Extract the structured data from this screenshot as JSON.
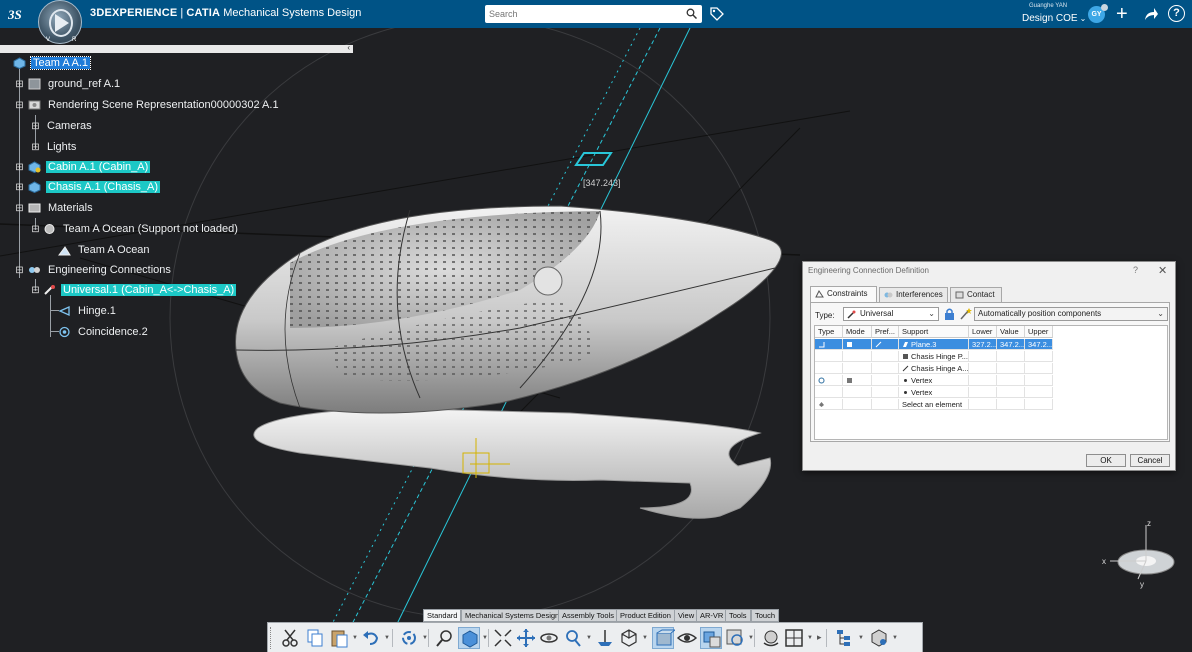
{
  "app": {
    "brand": "3DEXPERIENCE",
    "product": "CATIA",
    "app_name": "Mechanical Systems Design",
    "compass_labels": [
      "V",
      "R"
    ],
    "user_name": "Guanghe YAN",
    "role": "Design COE",
    "avatar_initials": "GY"
  },
  "search": {
    "placeholder": "Search"
  },
  "tree": {
    "items": [
      {
        "label": "Team A A.1",
        "state": "selected",
        "icon": "product-icon"
      },
      {
        "label": "ground_ref A.1",
        "icon": "part-icon"
      },
      {
        "label": "Rendering Scene Representation00000302 A.1",
        "icon": "scene-icon"
      },
      {
        "label": "Cameras",
        "icon": ""
      },
      {
        "label": "Lights",
        "icon": ""
      },
      {
        "label": "Cabin A.1 (Cabin_A)",
        "state": "highlight",
        "icon": "product-icon"
      },
      {
        "label": "Chasis A.1 (Chasis_A)",
        "state": "highlight",
        "icon": "product-icon"
      },
      {
        "label": "Materials",
        "icon": "materials-icon"
      },
      {
        "label": "Team A Ocean (Support not loaded)",
        "icon": "material-icon"
      },
      {
        "label": "Team A Ocean",
        "icon": "material-apply-icon"
      },
      {
        "label": "Engineering Connections",
        "icon": "connections-icon"
      },
      {
        "label": "Universal.1 (Cabin_A<->Chasis_A)",
        "state": "highlight",
        "icon": "universal-joint-icon"
      },
      {
        "label": "Hinge.1",
        "icon": "hinge-icon"
      },
      {
        "label": "Coincidence.2",
        "icon": "coincidence-icon"
      }
    ]
  },
  "viewport": {
    "annotation": "[347.243]"
  },
  "dialog": {
    "title": "Engineering Connection Definition",
    "help": "?",
    "close": "✕",
    "tabs": [
      "Constraints",
      "Interferences",
      "Contact"
    ],
    "type_label": "Type:",
    "type_value": "Universal",
    "auto_value": "Automatically position components",
    "columns": [
      "Type",
      "Mode",
      "Pref...",
      "Support",
      "Lower",
      "Value",
      "Upper"
    ],
    "rows": [
      {
        "support": "Plane.3",
        "lower": "327.2...",
        "value": "347.2...",
        "upper": "347.2...",
        "selected": true
      },
      {
        "support": "Chasis Hinge P..."
      },
      {
        "support": "Chasis Hinge A..."
      },
      {
        "support": "Vertex"
      },
      {
        "support": "Vertex"
      },
      {
        "support": "Select an element"
      }
    ],
    "ok": "OK",
    "cancel": "Cancel"
  },
  "toolbar_tabs": [
    "Standard",
    "Mechanical Systems Design",
    "Assembly Tools",
    "Product Edition",
    "View",
    "AR-VR",
    "Tools",
    "Touch"
  ],
  "toolbar_icons": [
    "cut-icon",
    "copy-icon",
    "paste-icon",
    "undo-icon",
    "update-icon",
    "fly-mode-icon",
    "zoom-icon",
    "view-mode-icon",
    "fit-all-icon",
    "pan-icon",
    "rotate-icon",
    "zoom-area-icon",
    "normal-view-icon",
    "iso-view-icon",
    "shading-icon",
    "hide-show-icon",
    "swap-visible-icon",
    "render-icon",
    "multi-view-icon",
    "tree-expand-icon",
    "product-view-icon"
  ],
  "axes": {
    "x": "x",
    "y": "y",
    "z": "z"
  },
  "colors": {
    "topbar": "#005386",
    "highlight": "#1cc8c6",
    "selection": "#1e7bd8",
    "viewport": "#1f2023"
  }
}
